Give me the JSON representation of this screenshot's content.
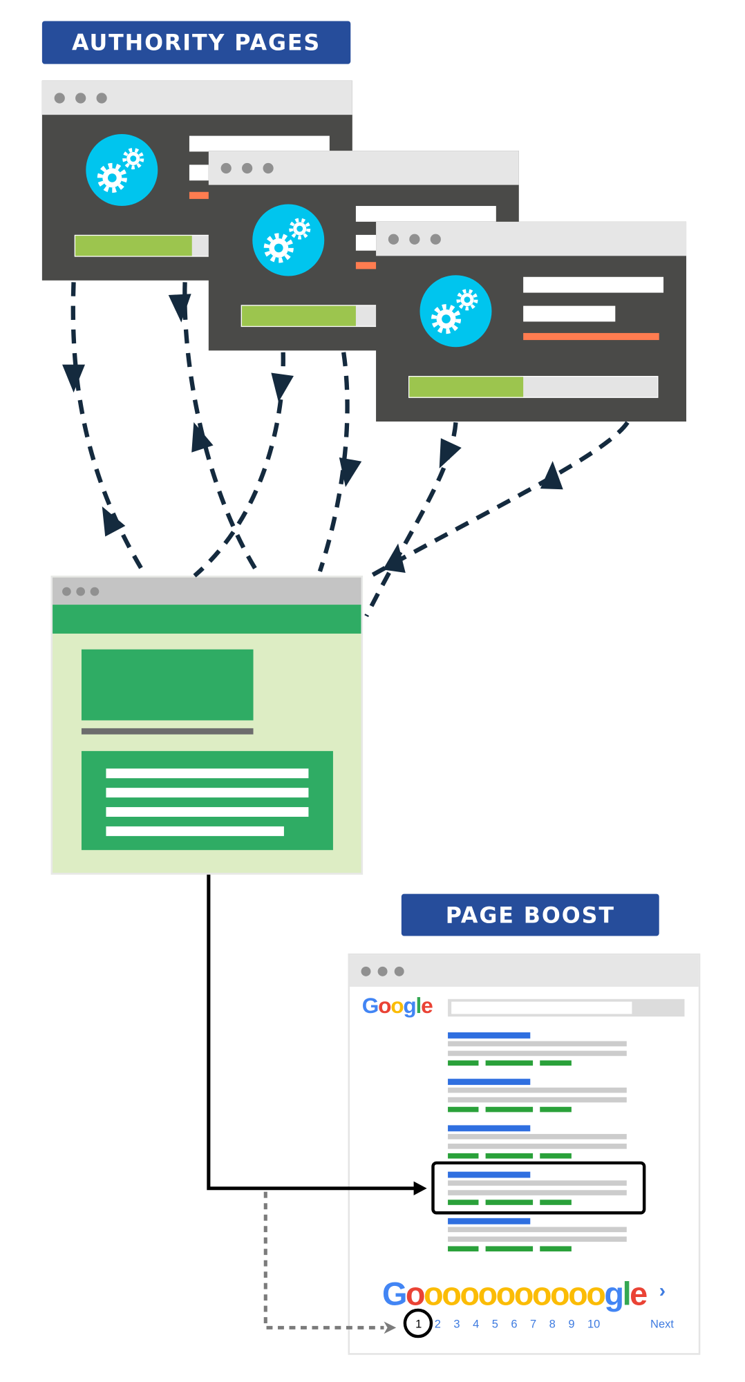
{
  "labels": {
    "authority": "AUTHORITY PAGES",
    "boost": "PAGE BOOST"
  },
  "authority_windows": [
    {
      "progress": 0.47
    },
    {
      "progress": 0.46
    },
    {
      "progress": 0.46
    }
  ],
  "google": {
    "logo": "Google",
    "pager_logo": "Gooooooooooogle",
    "pages": [
      "1",
      "2",
      "3",
      "4",
      "5",
      "6",
      "7",
      "8",
      "9",
      "10"
    ],
    "current_page": "1",
    "next": "Next",
    "next_icon": "chevron-right-icon",
    "result_count": 5,
    "highlighted_result": 4
  },
  "colors": {
    "banner": "#264d9b",
    "window_dark": "#4a4a48",
    "gear": "#00c5ee",
    "progress": "#9cc54e",
    "accent_orange": "#ff7c50",
    "site_green": "#2fac64",
    "site_bg": "#ddedc4",
    "arrow": "#142a3e",
    "google_blue": "#4285f4",
    "google_red": "#ea4335",
    "google_yellow": "#fbbc05",
    "google_green": "#34a853"
  }
}
